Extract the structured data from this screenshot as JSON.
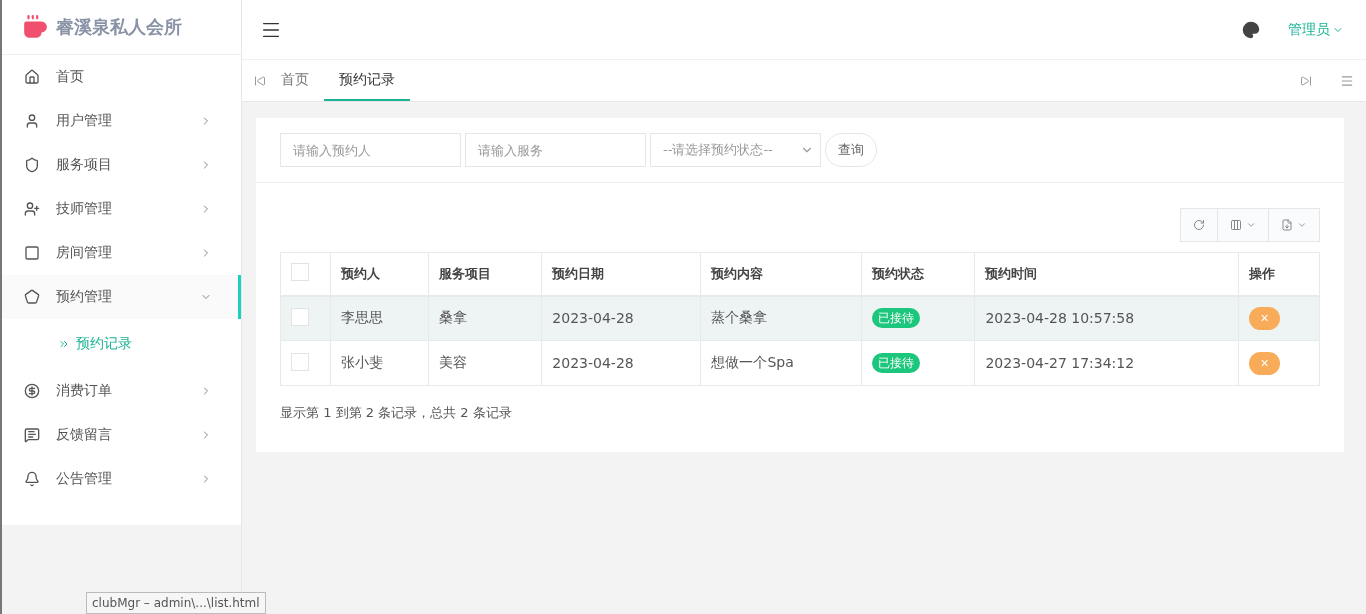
{
  "brand": {
    "title": "睿溪泉私人会所"
  },
  "sidebar": {
    "items": [
      {
        "label": "首页",
        "kind": "link"
      },
      {
        "label": "用户管理",
        "kind": "menu",
        "expanded": false
      },
      {
        "label": "服务项目",
        "kind": "menu",
        "expanded": false
      },
      {
        "label": "技师管理",
        "kind": "menu",
        "expanded": false
      },
      {
        "label": "房间管理",
        "kind": "menu",
        "expanded": false
      },
      {
        "label": "预约管理",
        "kind": "menu",
        "expanded": true,
        "children": [
          {
            "label": "预约记录",
            "selected": true
          }
        ]
      },
      {
        "label": "消费订单",
        "kind": "menu",
        "expanded": false
      },
      {
        "label": "反馈留言",
        "kind": "menu",
        "expanded": false
      },
      {
        "label": "公告管理",
        "kind": "menu",
        "expanded": false
      }
    ]
  },
  "header": {
    "user": "管理员"
  },
  "tabs": [
    {
      "label": "首页",
      "selected": false
    },
    {
      "label": "预约记录",
      "selected": true
    }
  ],
  "search": {
    "fields": [
      {
        "placeholder": "请输入预约人"
      },
      {
        "placeholder": "请输入服务"
      }
    ],
    "select": "--请选择预约状态--",
    "button": "查询"
  },
  "table": {
    "select_all": false,
    "columns": [
      "预约人",
      "服务项目",
      "预约日期",
      "预约内容",
      "预约状态",
      "预约时间",
      "操作"
    ],
    "rows": [
      {
        "selected": false,
        "highlighted": true,
        "cells": [
          "李思思",
          "桑拿",
          "2023-04-28",
          "蒸个桑拿"
        ],
        "status": "已接待",
        "time": "2023-04-28 10:57:58",
        "action": "×"
      },
      {
        "selected": false,
        "highlighted": false,
        "cells": [
          "张小斐",
          "美容",
          "2023-04-28",
          "想做一个Spa"
        ],
        "status": "已接待",
        "time": "2023-04-27 17:34:12",
        "action": "×"
      }
    ]
  },
  "pagination": "显示第 1 到第 2 条记录，总共 2 条记录",
  "status_bar": "clubMgr – admin\\...\\list.html"
}
